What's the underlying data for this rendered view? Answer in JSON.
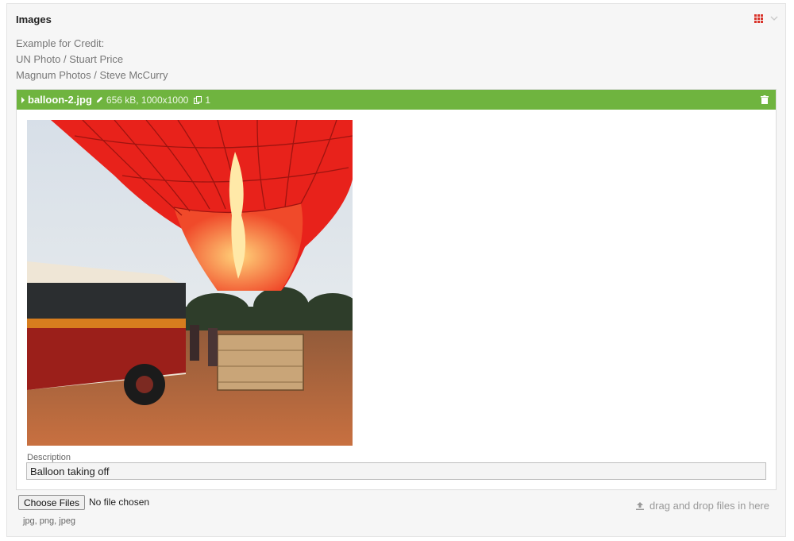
{
  "panel": {
    "title": "Images",
    "help_lines": [
      "Example for Credit:",
      "UN Photo / Stuart Price",
      "Magnum Photos / Steve McCurry"
    ]
  },
  "file": {
    "name": "balloon-2.jpg",
    "meta": "656 kB, 1000x1000",
    "copies": "1",
    "header_color": "#6fb43f",
    "description_label": "Description",
    "description_value": "Balloon taking off"
  },
  "upload": {
    "choose_label": "Choose Files",
    "no_file_text": "No file chosen",
    "dropzone_text": "drag and drop files in here",
    "extensions": "jpg, png, jpeg"
  },
  "icons": [
    "grid-icon",
    "chevron-down-icon",
    "caret-right-icon",
    "pencil-icon",
    "copy-icon",
    "trash-icon",
    "upload-icon"
  ]
}
